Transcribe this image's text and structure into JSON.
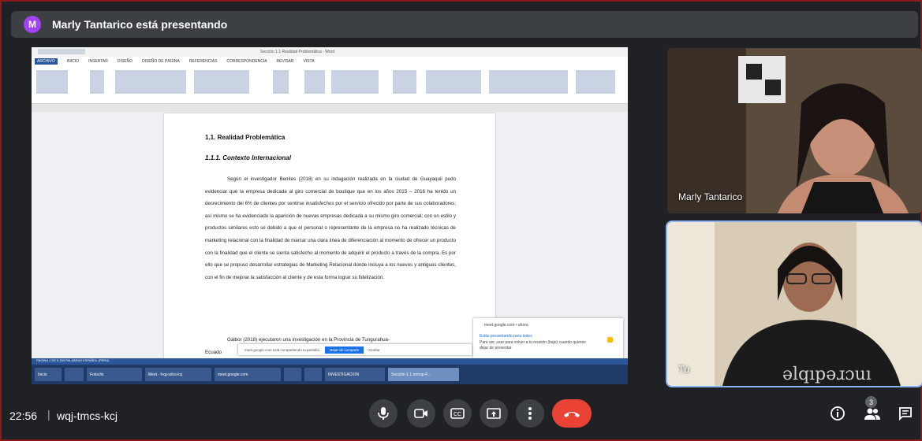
{
  "presenter": {
    "avatar_letter": "M",
    "banner_text": "Marly Tantarico está presentando",
    "avatar_color": "#a142f4"
  },
  "shared_screen": {
    "window_title": "Sección 1.1 Realidad Problemática - Word",
    "ribbon_tabs": [
      "ARCHIVO",
      "INICIO",
      "INSERTAR",
      "DISEÑO",
      "DISEÑO DE PÁGINA",
      "REFERENCIAS",
      "CORRESPONDENCIA",
      "REVISAR",
      "VISTA"
    ],
    "active_ribbon_tab": "ARCHIVO",
    "document": {
      "heading1": "1.1.  Realidad Problemática",
      "heading2": "1.1.1.  Contexto Internacional",
      "paragraph1": "Según el investigador Benites (2018) en su indagación realizada en la ciudad de Guayaquil pudo evidenciar que la empresa dedicada al giro comercial de boutique que en los años 2015 – 2016 ha tenido un decrecimiento del 6% de clientes por sentirse insatisfechos por el servicio ofrecido por parte de sus colaboradores; así mismo se ha evidenciado la aparición de nuevas empresas dedicada a su mismo giro comercial; con un estilo y productos similares esto se debido a que el personal o representante de la empresa no ha realizado técnicas de marketing relacional con la finalidad de marcar una clara línea de diferenciación al momento de ofrecer un producto con la finalidad que el cliente se sienta satisfecho al momento de adquirir el producto a través de la compra. Es por ello que se propuso desarrollar estrategias de Marketing Relacional donde incluya a los nuevos y antiguos clientes, con el fin de mejorar la satisfacción al cliente y de esta forma lograr su fidelización.",
      "paragraph2": "Galbor (2018) ejecutaron una investigación en la Provincia de Tungurahua-",
      "paragraph3_start": "Ecuado"
    },
    "status_bar": "PÁGINA 1 DE 5    300 PALABRAS    ESPAÑOL (PERÚ)",
    "share_bar": {
      "text": "meet.google.com está compartiendo tu pantalla.",
      "stop_label": "Dejar de compartir",
      "hide_label": "Ocultar"
    },
    "notification": {
      "source": "meet.google.com • ahora",
      "title": "Estás presentando para todos",
      "body": "Para ver, usar para volver a tu reunión (bajo) cuando quieres dejar de presentar"
    },
    "taskbar_items": [
      {
        "label": "Inicio",
        "active": false
      },
      {
        "label": "",
        "active": false
      },
      {
        "label": "Fotoclin",
        "active": false
      },
      {
        "label": "Meet - hxg-xdcs-kcj",
        "active": false
      },
      {
        "label": "meet.google.com",
        "active": false
      },
      {
        "label": "",
        "active": false
      },
      {
        "label": "",
        "active": false
      },
      {
        "label": "INVESTIGACION",
        "active": false
      },
      {
        "label": "Sección 1.1 ontrop-F...",
        "active": true
      }
    ]
  },
  "participants": [
    {
      "name": "Marly Tantarico"
    },
    {
      "name": "Tú"
    }
  ],
  "bottom_bar": {
    "time": "22:56",
    "separator": "|",
    "meeting_code": "wqj-tmcs-kcj",
    "participant_count": "3",
    "end_call_color": "#ea4335"
  }
}
